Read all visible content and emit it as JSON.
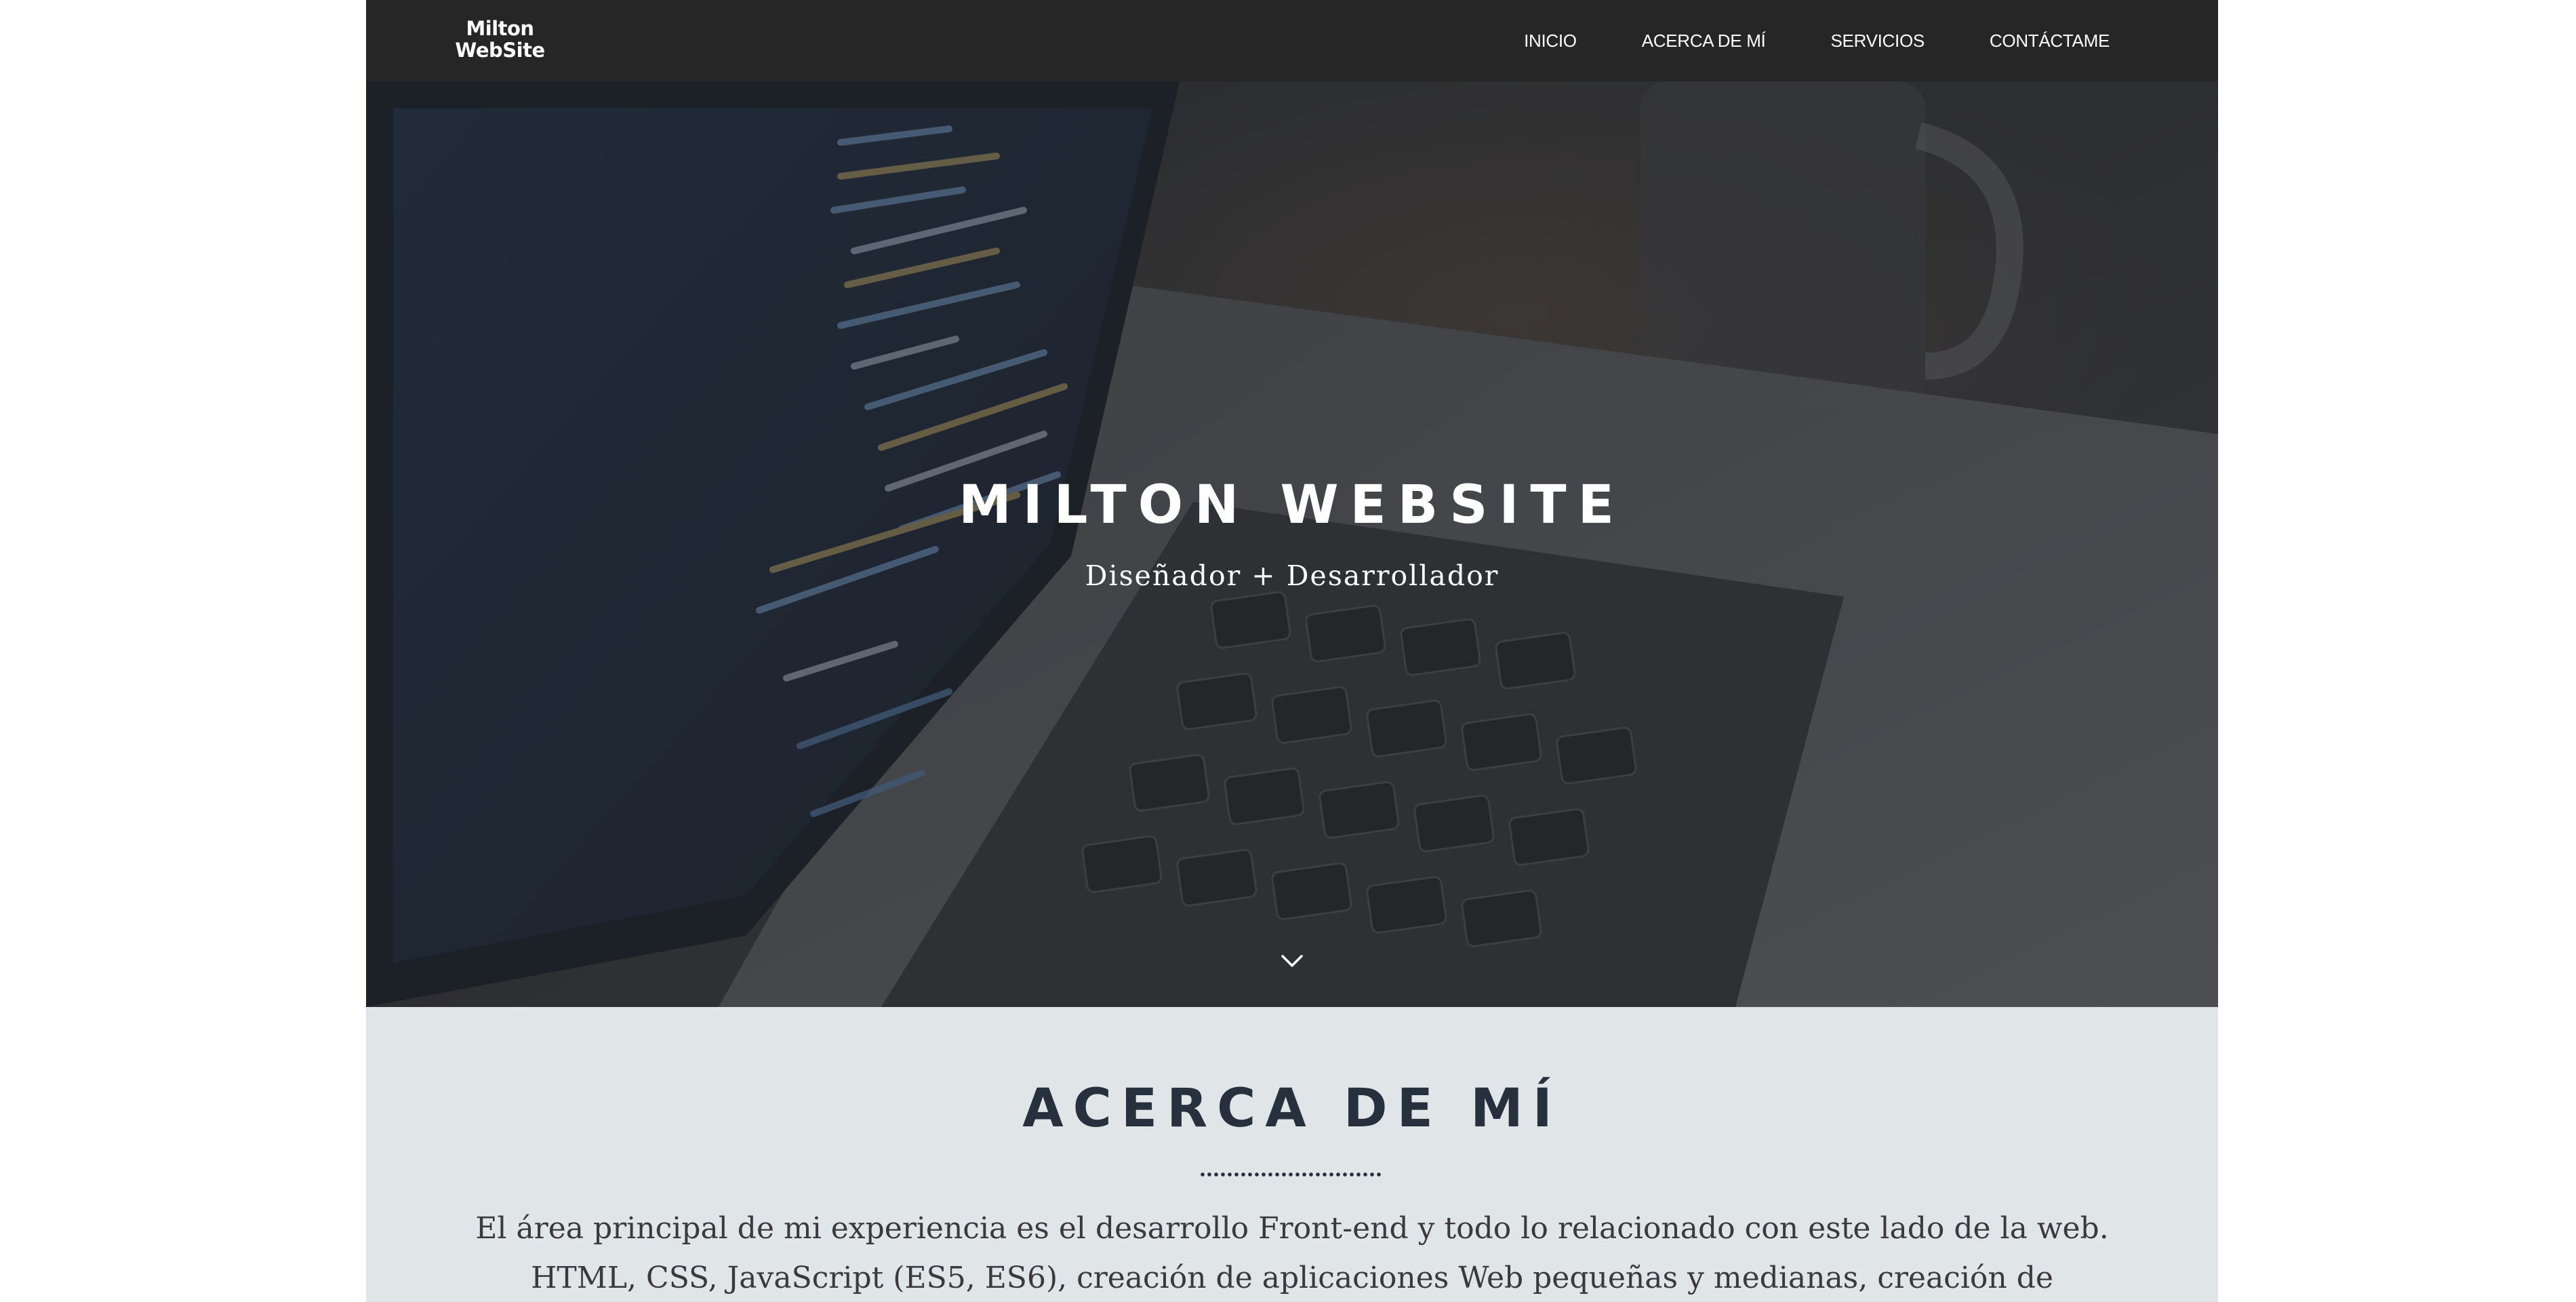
{
  "navbar": {
    "logo_line1": "Milton",
    "logo_line2": "WebSite",
    "links": [
      {
        "label": "INICIO"
      },
      {
        "label": "ACERCA DE MÍ"
      },
      {
        "label": "SERVICIOS"
      },
      {
        "label": "CONTÁCTAME"
      }
    ]
  },
  "hero": {
    "title": "MILTON WEBSITE",
    "subtitle": "Diseñador + Desarrollador",
    "scroll_icon": "chevron-down-icon",
    "background": "laptop-code-photo"
  },
  "about": {
    "title": "ACERCA DE MÍ",
    "text": "El área principal de mi experiencia es el desarrollo Front-end y todo lo relacionado con este lado de la web. HTML, CSS, JavaScript (ES5, ES6), creación de aplicaciones Web pequeñas y medianas, creación de complementos personalizados,"
  },
  "colors": {
    "navbar_bg": "#262626",
    "about_bg": "#e0e5e7",
    "heading_dark": "#26313d",
    "body_text": "#3a3a3a"
  }
}
